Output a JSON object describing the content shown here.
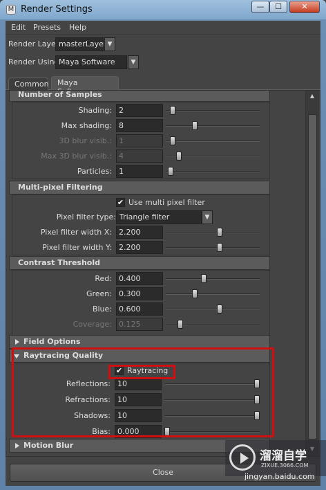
{
  "window": {
    "title": "Render Settings",
    "min_glyph": "—",
    "max_glyph": "☐",
    "close_glyph": "✕"
  },
  "menu": [
    "Edit",
    "Presets",
    "Help"
  ],
  "render_layer": {
    "label": "Render Layer",
    "value": "masterLayer"
  },
  "render_using": {
    "label": "Render Using",
    "value": "Maya Software"
  },
  "tabs": [
    {
      "label": "Common",
      "selected": false
    },
    {
      "label": "Maya Software",
      "selected": true
    }
  ],
  "sections": {
    "number_of_samples": {
      "title": "Number of Samples",
      "rows": [
        {
          "label": "Shading:",
          "value": "2",
          "slider": 0.05,
          "enabled": true
        },
        {
          "label": "Max shading:",
          "value": "8",
          "slider": 0.3,
          "enabled": true
        },
        {
          "label": "3D blur visib.:",
          "value": "1",
          "slider": 0.05,
          "enabled": false
        },
        {
          "label": "Max 3D blur visib.:",
          "value": "4",
          "slider": 0.12,
          "enabled": false
        },
        {
          "label": "Particles:",
          "value": "1",
          "slider": 0.02,
          "enabled": true
        }
      ]
    },
    "multi_pixel_filtering": {
      "title": "Multi-pixel Filtering",
      "use_filter": {
        "label": "Use multi pixel filter",
        "checked": true
      },
      "filter_type": {
        "label": "Pixel filter type:",
        "value": "Triangle filter"
      },
      "rows": [
        {
          "label": "Pixel filter width X:",
          "value": "2.200",
          "slider": 0.58,
          "enabled": true
        },
        {
          "label": "Pixel filter width Y:",
          "value": "2.200",
          "slider": 0.58,
          "enabled": true
        }
      ]
    },
    "contrast_threshold": {
      "title": "Contrast Threshold",
      "rows": [
        {
          "label": "Red:",
          "value": "0.400",
          "slider": 0.4,
          "enabled": true
        },
        {
          "label": "Green:",
          "value": "0.300",
          "slider": 0.3,
          "enabled": true
        },
        {
          "label": "Blue:",
          "value": "0.600",
          "slider": 0.58,
          "enabled": true
        },
        {
          "label": "Coverage:",
          "value": "0.125",
          "slider": 0.13,
          "enabled": false
        }
      ]
    },
    "field_options": {
      "title": "Field Options",
      "expanded": false
    },
    "raytracing_quality": {
      "title": "Raytracing Quality",
      "raytracing": {
        "label": "Raytracing",
        "checked": true
      },
      "rows": [
        {
          "label": "Reflections:",
          "value": "10",
          "slider": 1.0,
          "enabled": true
        },
        {
          "label": "Refractions:",
          "value": "10",
          "slider": 1.0,
          "enabled": true
        },
        {
          "label": "Shadows:",
          "value": "10",
          "slider": 1.0,
          "enabled": true
        },
        {
          "label": "Bias:",
          "value": "0.000",
          "slider": 0.0,
          "enabled": true
        }
      ]
    },
    "motion_blur": {
      "title": "Motion Blur",
      "expanded": false
    }
  },
  "close_button": "Close",
  "watermark": {
    "title": "溜溜自学",
    "subtitle": "ZIXUE.3066.COM",
    "baidu": "jingyan.baidu.com"
  },
  "colors": {
    "highlight": "#d01010",
    "titlebar": "#7fa7cc",
    "panel": "#444444"
  }
}
